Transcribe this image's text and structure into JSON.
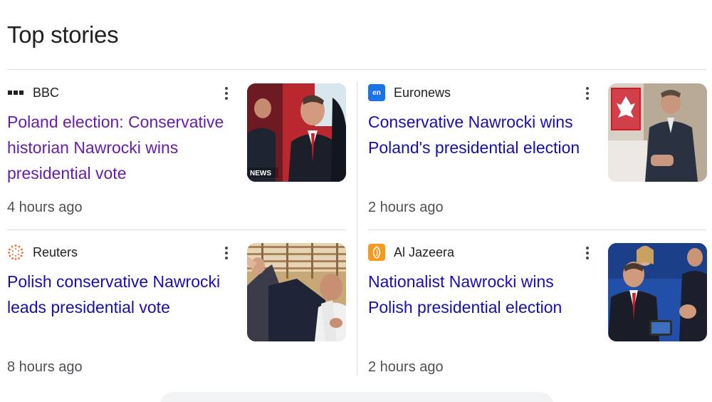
{
  "section": {
    "title": "Top stories"
  },
  "stories": [
    {
      "source": "BBC",
      "favicon": "bbc-blocks-icon",
      "headline": "Poland election: Conservative historian Nawrocki wins presidential vote",
      "time": "4 hours ago",
      "visited": true,
      "thumb_caption": "NEWS"
    },
    {
      "source": "Euronews",
      "favicon": "euronews-icon",
      "favicon_text": "en",
      "headline": "Conservative Nawrocki wins Poland's presidential election",
      "time": "2 hours ago",
      "visited": false
    },
    {
      "source": "Reuters",
      "favicon": "reuters-icon",
      "headline": "Polish conservative Nawrocki leads presidential vote",
      "time": "8 hours ago",
      "visited": false
    },
    {
      "source": "Al Jazeera",
      "favicon": "al-jazeera-icon",
      "headline": "Nationalist Nawrocki wins Polish presidential election",
      "time": "2 hours ago",
      "visited": false
    }
  ],
  "colors": {
    "link": "#1a0dab",
    "visited_link": "#681da8",
    "euronews_brand": "#1c73e8",
    "aljazeera_brand": "#f39a1f",
    "reuters_brand": "#f46a26"
  }
}
